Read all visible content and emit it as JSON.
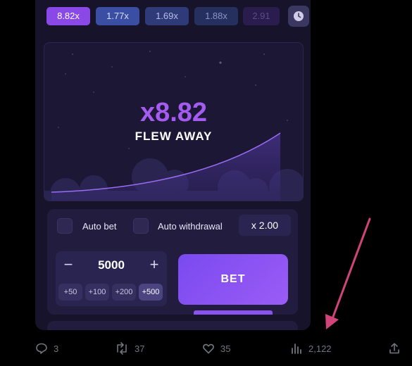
{
  "history": [
    "8.82x",
    "1.77x",
    "1.69x",
    "1.88x",
    "2.91"
  ],
  "game": {
    "multiplier": "x8.82",
    "status": "FLEW AWAY"
  },
  "bet_panel": {
    "auto_bet_label": "Auto bet",
    "auto_withdrawal_label": "Auto withdrawal",
    "withdrawal_multiplier": "x 2.00",
    "minus": "−",
    "amount": "5000",
    "plus": "+",
    "chips": [
      "+50",
      "+100",
      "+200",
      "+500"
    ],
    "bet_label": "BET"
  },
  "post_actions": {
    "replies": "3",
    "reposts": "37",
    "likes": "35",
    "views": "2,122"
  },
  "icons": {
    "history": "clock-icon",
    "reply": "reply-icon",
    "repost": "repost-icon",
    "like": "heart-icon",
    "views": "views-icon",
    "share": "share-icon"
  },
  "colors": {
    "accent": "#8a49e6",
    "multiplier": "#a35bf0",
    "annotation_arrow": "#d1447a"
  }
}
